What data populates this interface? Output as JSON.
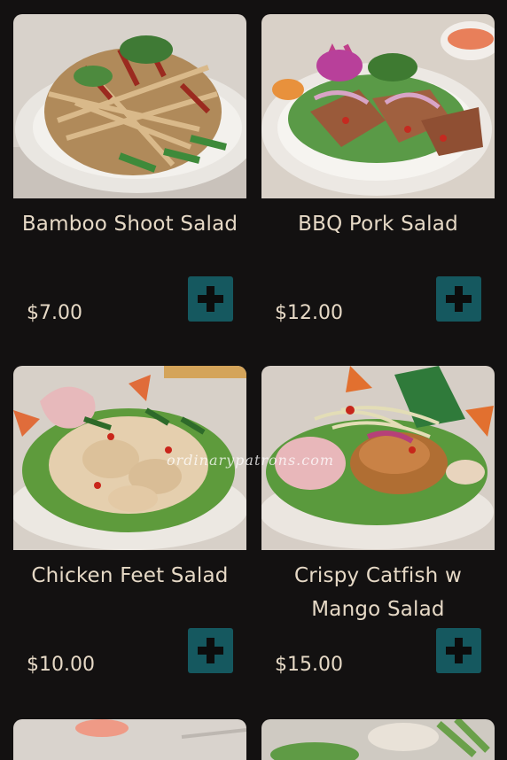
{
  "menu": {
    "items": [
      {
        "name": "Bamboo Shoot Salad",
        "price": "$7.00",
        "add_icon": "plus-icon"
      },
      {
        "name": "BBQ Pork Salad",
        "price": "$12.00",
        "add_icon": "plus-icon"
      },
      {
        "name": "Chicken Feet Salad",
        "price": "$10.00",
        "add_icon": "plus-icon"
      },
      {
        "name": "Crispy Catfish w Mango Salad",
        "price": "$15.00",
        "add_icon": "plus-icon"
      }
    ]
  },
  "watermark": "ordinarypatrons.com",
  "colors": {
    "background": "#131111",
    "text": "#e6d9c6",
    "button": "#15585f"
  }
}
